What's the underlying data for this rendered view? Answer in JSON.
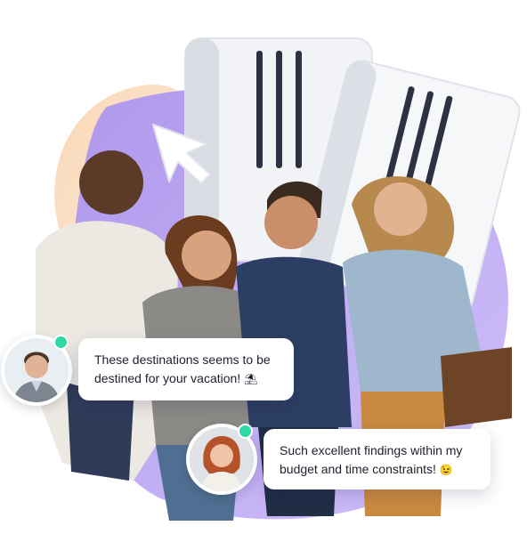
{
  "messages": [
    {
      "text": "These destinations seems to be destined for your vacation!",
      "emoji": "⛱"
    },
    {
      "text": "Such excellent findings within my budget and time constraints!",
      "emoji": "😉"
    }
  ],
  "icons": {
    "ticket_front": "ticket-icon",
    "ticket_back": "ticket-icon",
    "cursor": "cursor-arrow-icon",
    "status": "online-status-icon"
  },
  "colors": {
    "purple_blob": "#b9a4f2",
    "peach_blob": "#f9d6b5",
    "status_dot": "#2fd9a6",
    "ticket_body": "#f2f3f6",
    "ticket_stripes": "#2d3142"
  }
}
